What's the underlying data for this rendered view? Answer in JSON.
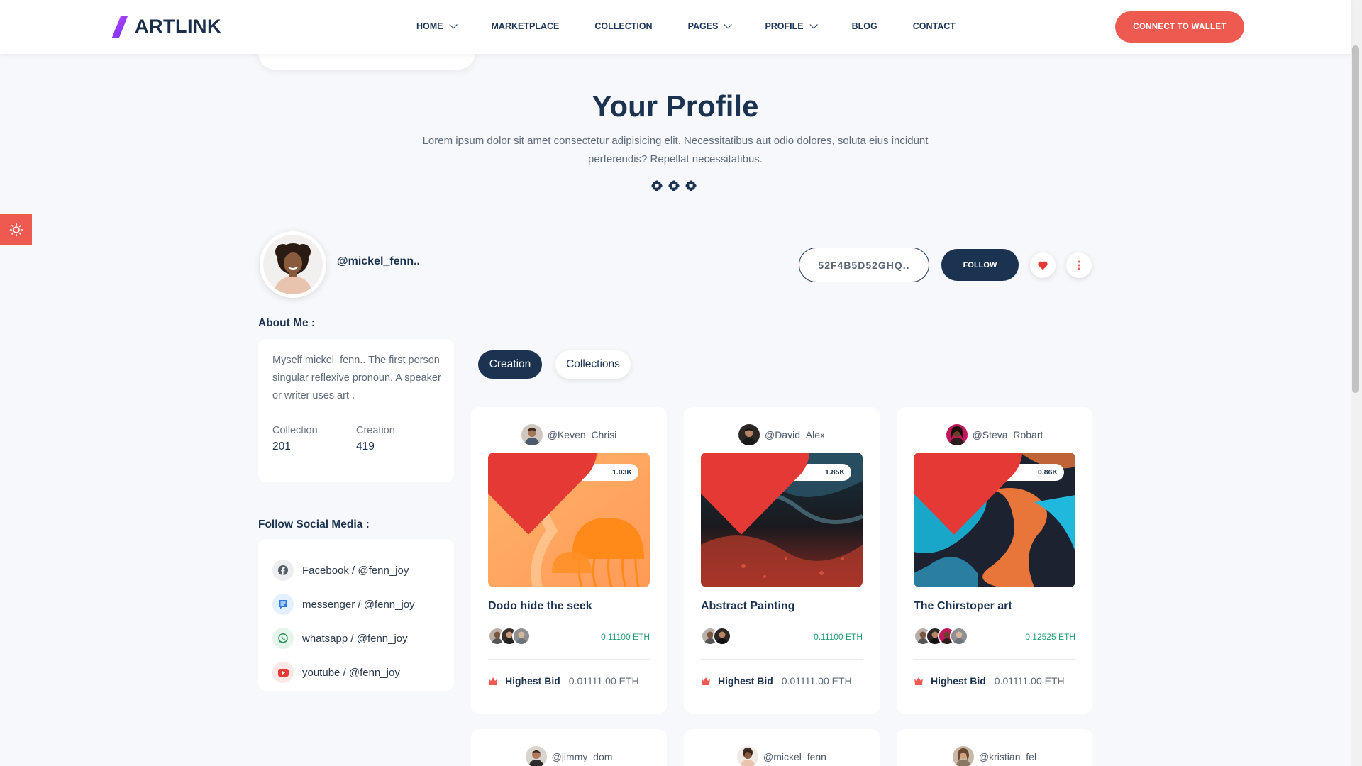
{
  "brand": {
    "name": "ARTLINK"
  },
  "nav": {
    "items": [
      {
        "label": "HOME",
        "dropdown": true
      },
      {
        "label": "MARKETPLACE",
        "dropdown": false
      },
      {
        "label": "COLLECTION",
        "dropdown": false
      },
      {
        "label": "PAGES",
        "dropdown": true
      },
      {
        "label": "PROFILE",
        "dropdown": true
      },
      {
        "label": "BLOG",
        "dropdown": false
      },
      {
        "label": "CONTACT",
        "dropdown": false
      }
    ],
    "connect_label": "CONNECT TO WALLET"
  },
  "hero": {
    "title": "Your Profile",
    "description": "Lorem ipsum dolor sit amet consectetur adipisicing elit. Necessitatibus aut odio dolores, soluta eius incidunt perferendis? Repellat necessitatibus."
  },
  "profile": {
    "username": "@mickel_fenn..",
    "wallet_id": "52F4B5D52GHQ..",
    "follow_label": "FOLLOW"
  },
  "about": {
    "heading": "About Me :",
    "text": "Myself mickel_fenn.. The first person singular reflexive pronoun. A speaker or writer uses art .",
    "stats": [
      {
        "label": "Collection",
        "value": "201"
      },
      {
        "label": "Creation",
        "value": "419"
      }
    ]
  },
  "social": {
    "heading": "Follow Social Media :",
    "items": [
      {
        "label": "Facebook / @fenn_joy",
        "icon": "facebook-icon",
        "color": "#555d66",
        "bg": "#eceef1"
      },
      {
        "label": "messenger / @fenn_joy",
        "icon": "messenger-icon",
        "color": "#2d7be5",
        "bg": "#e4efff"
      },
      {
        "label": "whatsapp / @fenn_joy",
        "icon": "whatsapp-icon",
        "color": "#2a8f5a",
        "bg": "#e5f5ec"
      },
      {
        "label": "youtube / @fenn_joy",
        "icon": "youtube-icon",
        "color": "#e53935",
        "bg": "#fde8e8"
      }
    ]
  },
  "tabs": [
    {
      "label": "Creation",
      "active": true
    },
    {
      "label": "Collections",
      "active": false
    }
  ],
  "cards": [
    {
      "author": "@Keven_Chrisi",
      "likes": "1.03K",
      "title": "Dodo hide the seek",
      "price": "0.11100 ETH",
      "highest_label": "Highest Bid",
      "highest_value": "0.01111.00 ETH",
      "bidders": 3
    },
    {
      "author": "@David_Alex",
      "likes": "1.85K",
      "title": "Abstract Painting",
      "price": "0.11100 ETH",
      "highest_label": "Highest Bid",
      "highest_value": "0.01111.00 ETH",
      "bidders": 2
    },
    {
      "author": "@Steva_Robart",
      "likes": "0.86K",
      "title": "The Chirstoper art",
      "price": "0.12525 ETH",
      "highest_label": "Highest Bid",
      "highest_value": "0.01111.00 ETH",
      "bidders": 4
    }
  ],
  "cards_next_row": [
    {
      "author": "@jimmy_dom"
    },
    {
      "author": "@mickel_fenn"
    },
    {
      "author": "@kristian_fel"
    }
  ],
  "colors": {
    "accent": "#ef5a50",
    "navy": "#1b3350",
    "price_green": "#1f9d72",
    "background": "#f7f8fb"
  }
}
